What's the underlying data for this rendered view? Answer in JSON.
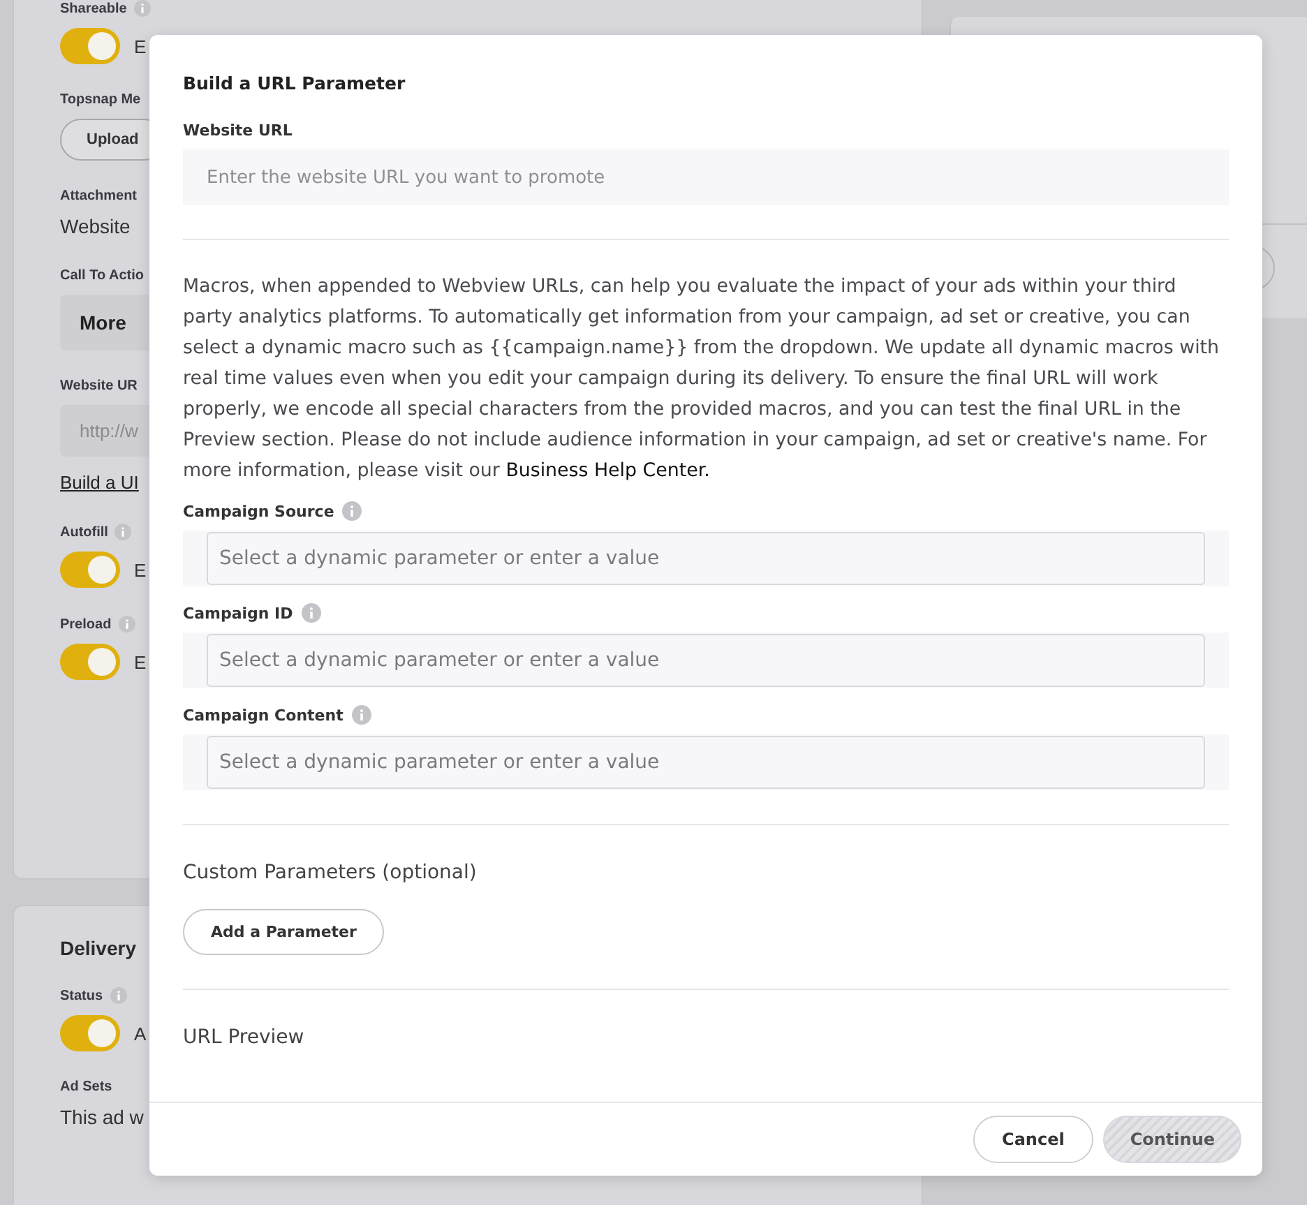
{
  "background": {
    "cards": [
      {
        "items": [
          {
            "kind": "label",
            "text": "Shareable",
            "info": true
          },
          {
            "kind": "toggle",
            "on": true,
            "label": "E"
          },
          {
            "kind": "label",
            "text": "Topsnap Me",
            "info": false
          },
          {
            "kind": "button",
            "text": "Upload"
          },
          {
            "kind": "label",
            "text": "Attachment",
            "info": false
          },
          {
            "kind": "value",
            "text": "Website"
          },
          {
            "kind": "label",
            "text": "Call To Actio",
            "info": false
          },
          {
            "kind": "select",
            "text": "More"
          },
          {
            "kind": "label",
            "text": "Website UR",
            "info": false
          },
          {
            "kind": "input",
            "text": "http://w"
          },
          {
            "kind": "link",
            "text": "Build a UI"
          },
          {
            "kind": "label",
            "text": "Autofill",
            "info": true
          },
          {
            "kind": "toggle",
            "on": true,
            "label": "E"
          },
          {
            "kind": "label",
            "text": "Preload",
            "info": true
          },
          {
            "kind": "toggle",
            "on": true,
            "label": "E"
          }
        ]
      },
      {
        "title": "Delivery",
        "items": [
          {
            "kind": "label",
            "text": "Status",
            "info": true
          },
          {
            "kind": "toggle",
            "on": true,
            "label": "A"
          },
          {
            "kind": "label",
            "text": "Ad Sets",
            "info": false
          },
          {
            "kind": "value",
            "text": "This ad w"
          }
        ]
      }
    ]
  },
  "modal": {
    "title": "Build a URL Parameter",
    "website_url": {
      "label": "Website URL",
      "placeholder": "Enter the website URL you want to promote"
    },
    "description": "Macros, when appended to Webview URLs, can help you evaluate the impact of your ads within your third party analytics platforms. To automatically get information from your campaign, ad set or creative, you can select a dynamic macro such as {{campaign.name}} from the dropdown. We update all dynamic macros with real time values even when you edit your campaign during its delivery. To ensure the final URL will work properly, we encode all special characters from the provided macros, and you can test the final URL in the Preview section. Please do not include audience information in your campaign, ad set or creative's name. For more information, please visit our",
    "help_link": "Business Help Center.",
    "fields": [
      {
        "label": "Campaign Source",
        "placeholder": "Select a dynamic parameter or enter a value"
      },
      {
        "label": "Campaign ID",
        "placeholder": "Select a dynamic parameter or enter a value"
      },
      {
        "label": "Campaign Content",
        "placeholder": "Select a dynamic parameter or enter a value"
      }
    ],
    "custom_parameters": {
      "heading": "Custom Parameters (optional)",
      "button": "Add a Parameter"
    },
    "url_preview": {
      "heading": "URL Preview"
    },
    "buttons": [
      {
        "label": "Cancel",
        "kind": "secondary",
        "disabled": false
      },
      {
        "label": "Continue",
        "kind": "primary",
        "disabled": true
      }
    ]
  }
}
